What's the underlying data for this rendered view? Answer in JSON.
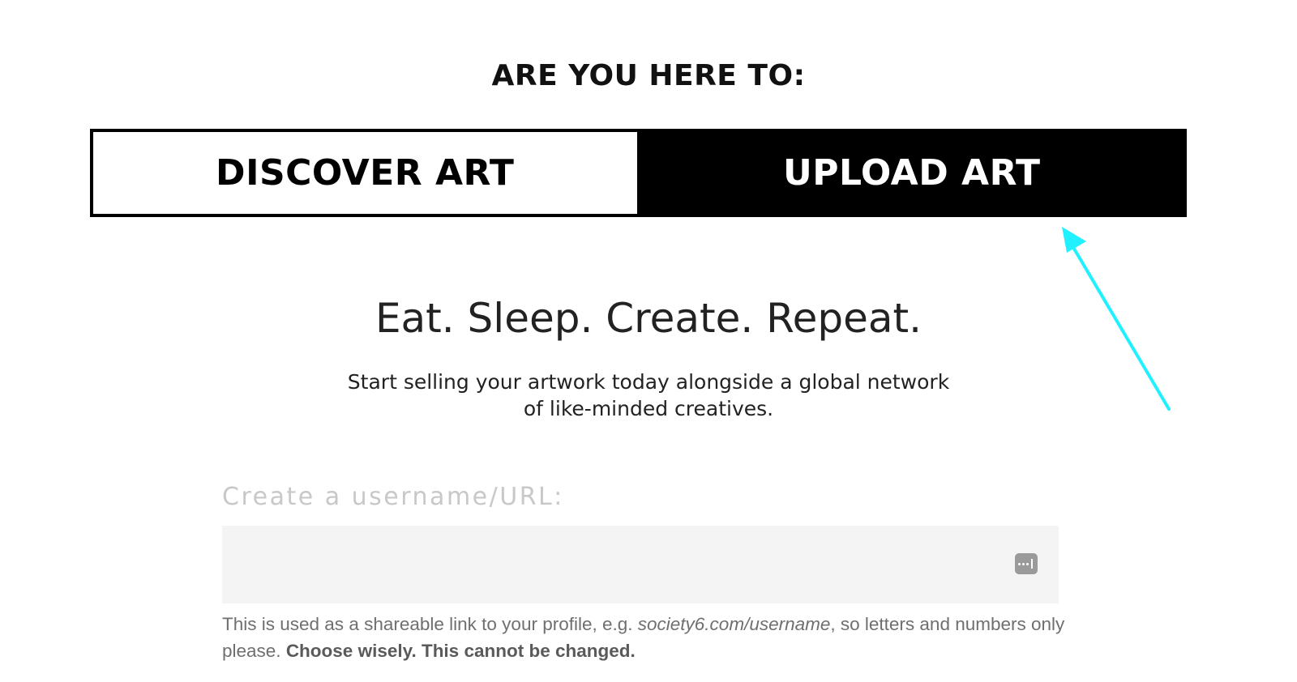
{
  "heading": "ARE YOU HERE TO:",
  "toggle": {
    "discover_label": "DISCOVER ART",
    "upload_label": "UPLOAD ART",
    "selected": "UPLOAD ART"
  },
  "hero": {
    "tagline": "Eat. Sleep. Create. Repeat.",
    "subtext_line1": "Start selling your artwork today alongside a global network",
    "subtext_line2": "of like-minded creatives."
  },
  "username": {
    "label": "Create a username/URL:",
    "value": "",
    "placeholder": "",
    "icon": "password-manager-icon",
    "help_part1": "This is used as a shareable link to your profile, e.g. ",
    "help_example": "society6.com/username",
    "help_part2": ", so letters and numbers only please. ",
    "help_warning": "Choose wisely. This cannot be changed."
  },
  "colors": {
    "active_tab_bg": "#000000",
    "active_tab_text": "#ffffff",
    "annotation_arrow": "#20f0ff",
    "field_bg": "#f4f4f4"
  }
}
